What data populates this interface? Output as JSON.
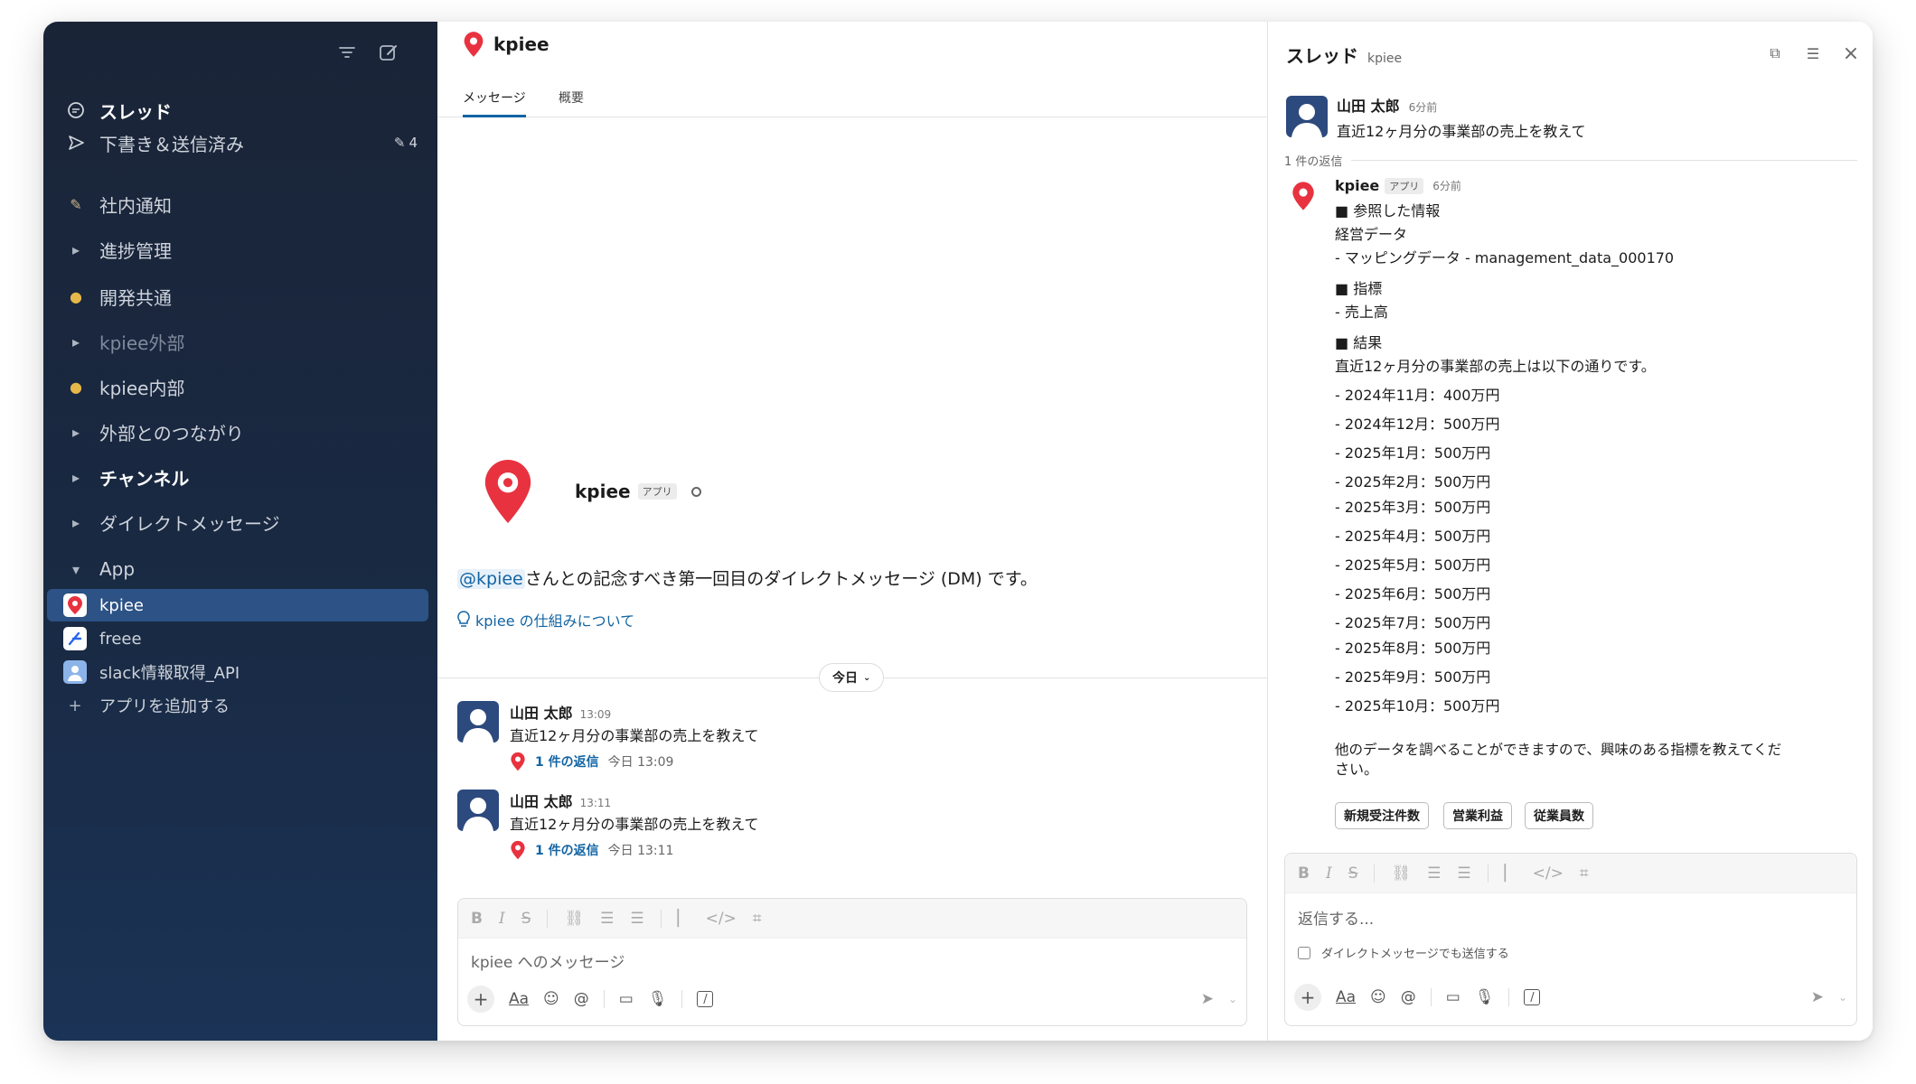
{
  "sidebar": {
    "threads": "スレッド",
    "drafts": "下書き＆送信済み",
    "drafts_count": "4",
    "items": [
      {
        "label": "社内通知"
      },
      {
        "label": "進捗管理"
      },
      {
        "label": "開発共通"
      },
      {
        "label": "kpiee外部"
      },
      {
        "label": "kpiee内部"
      },
      {
        "label": "外部とのつながり"
      },
      {
        "label": "チャンネル"
      },
      {
        "label": "ダイレクトメッセージ"
      },
      {
        "label": "App"
      }
    ],
    "apps": [
      {
        "label": "kpiee"
      },
      {
        "label": "freee"
      },
      {
        "label": "slack情報取得_API"
      }
    ],
    "add_app": "アプリを追加する"
  },
  "main": {
    "title": "kpiee",
    "tabs": [
      "メッセージ",
      "概要"
    ],
    "intro": {
      "name": "kpiee",
      "badge": "アプリ",
      "mention": "@kpiee",
      "text": "さんとの記念すべき第一回目のダイレクトメッセージ (DM) です。",
      "link": "kpiee の仕組みについて"
    },
    "date_divider": "今日",
    "messages": [
      {
        "user": "山田 太郎",
        "time": "13:09",
        "text": "直近12ヶ月分の事業部の売上を教えて",
        "reply_label": "1 件の返信",
        "reply_time": "今日 13:09"
      },
      {
        "user": "山田 太郎",
        "time": "13:11",
        "text": "直近12ヶ月分の事業部の売上を教えて",
        "reply_label": "1 件の返信",
        "reply_time": "今日 13:11"
      }
    ],
    "composer_placeholder": "kpiee へのメッセージ",
    "aa": "Aa"
  },
  "thread": {
    "title": "スレッド",
    "subtitle": "kpiee",
    "parent": {
      "user": "山田 太郎",
      "time": "6分前",
      "text": "直近12ヶ月分の事業部の売上を教えて"
    },
    "reply_count": "1 件の返信",
    "reply": {
      "user": "kpiee",
      "badge": "アプリ",
      "time": "6分前",
      "lines": [
        "■ 参照した情報",
        "経営データ",
        "- マッピングデータ - management_data_000170",
        "■ 指標",
        "- 売上高",
        "■ 結果",
        "直近12ヶ月分の事業部の売上は以下の通りです。",
        "- 2024年11月：400万円",
        "- 2024年12月：500万円",
        "- 2025年1月：500万円",
        "- 2025年2月：500万円",
        "- 2025年3月：500万円",
        "- 2025年4月：500万円",
        "- 2025年5月：500万円",
        "- 2025年6月：500万円",
        "- 2025年7月：500万円",
        "- 2025年8月：500万円",
        "- 2025年9月：500万円",
        "- 2025年10月：500万円",
        "他のデータを調べることができますので、興味のある指標を教えてくだ",
        "さい。"
      ],
      "chips": [
        "新規受注件数",
        "営業利益",
        "従業員数"
      ]
    },
    "composer_placeholder": "返信する...",
    "also_send": "ダイレクトメッセージでも送信する",
    "aa": "Aa"
  },
  "colors": {
    "sidebar": "#1a2437",
    "selected": "#2c5286",
    "link": "#1264a3",
    "brand": "#e8323f"
  }
}
